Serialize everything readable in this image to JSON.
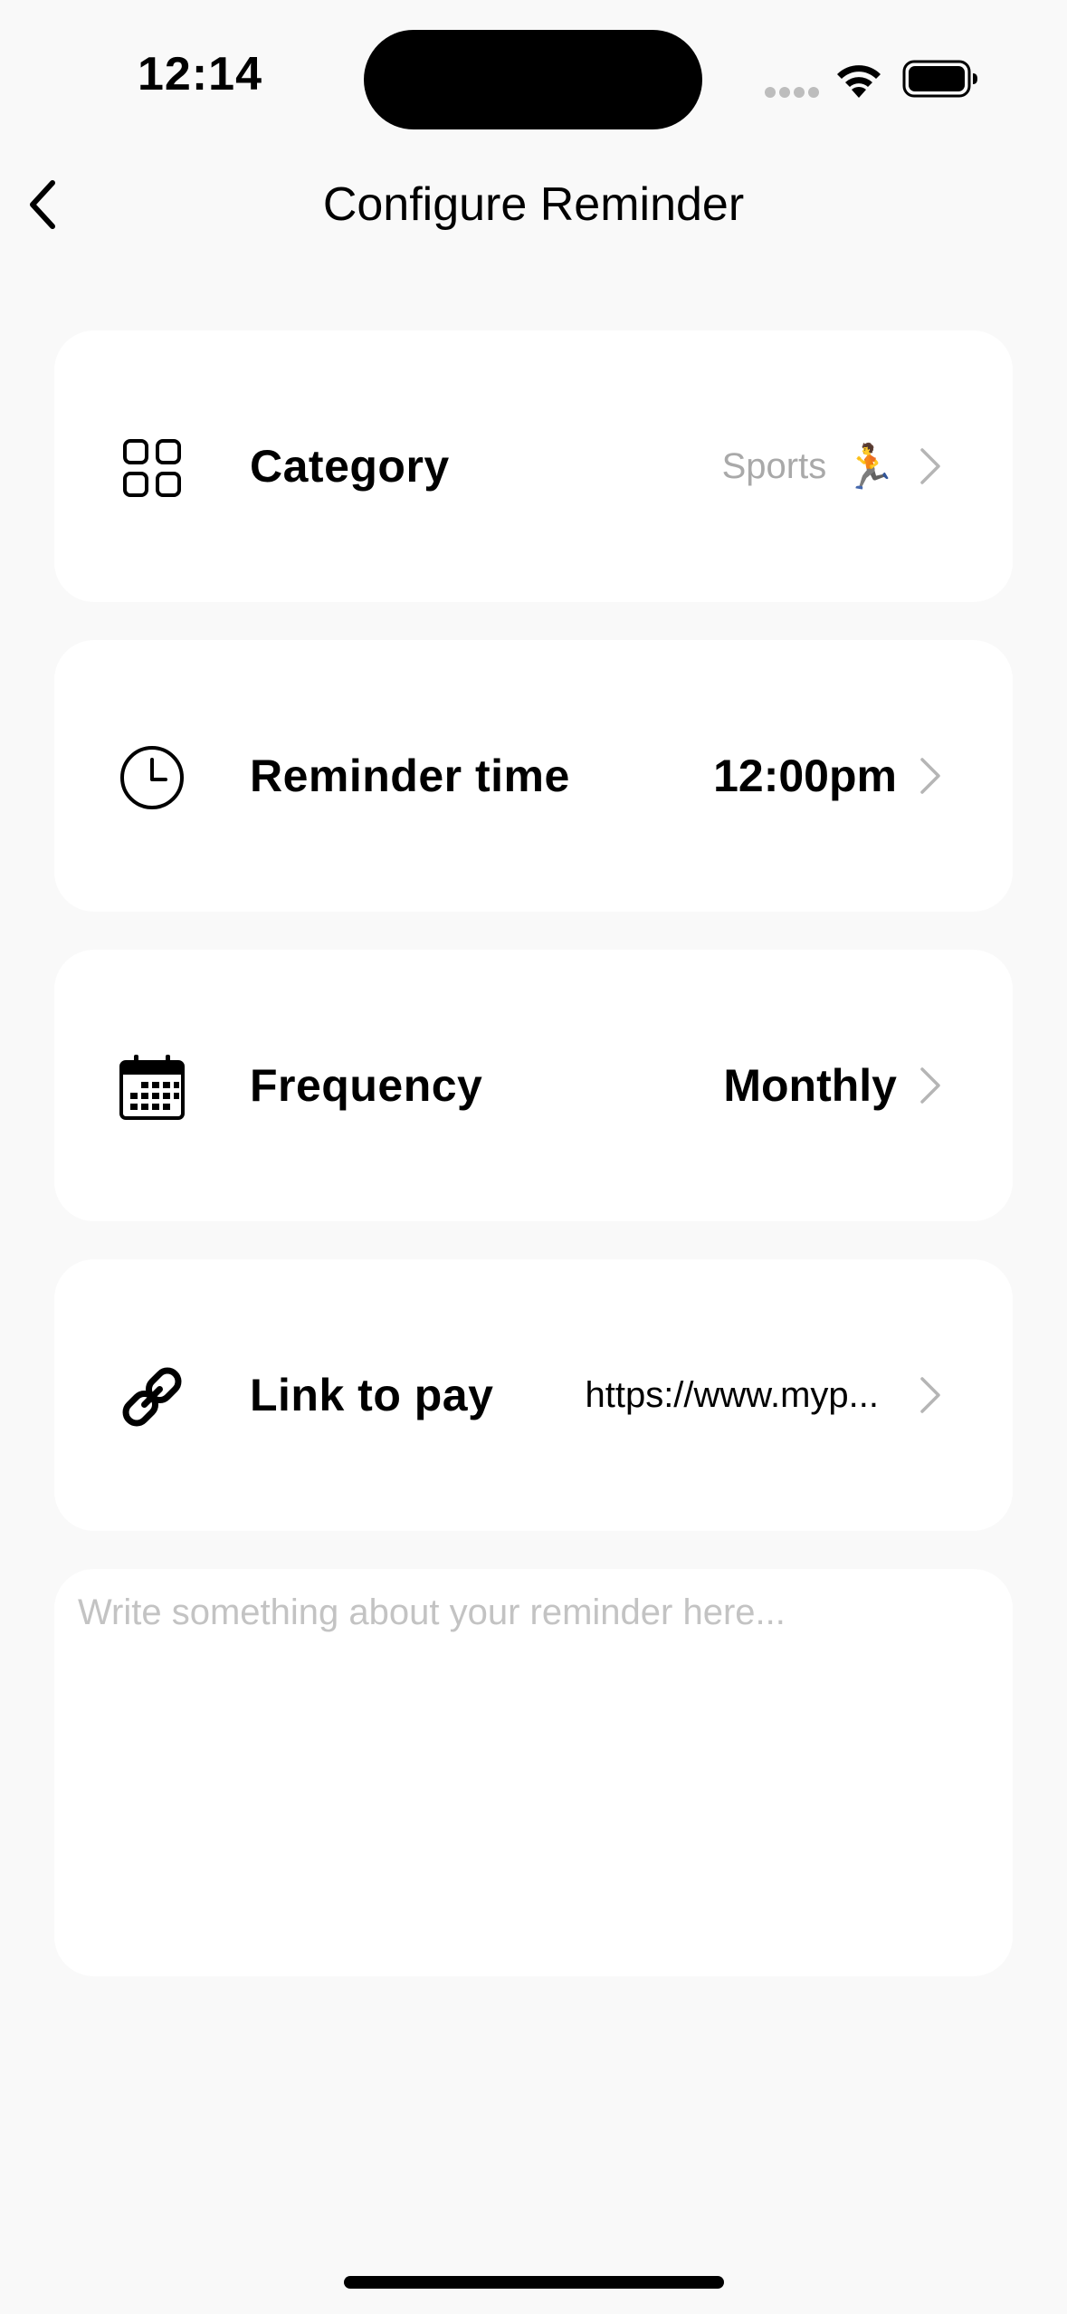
{
  "status_bar": {
    "time": "12:14"
  },
  "nav": {
    "title": "Configure Reminder",
    "back_icon": "chevron-left-icon"
  },
  "rows": [
    {
      "label": "Category",
      "value": "Sports",
      "value_emoji": "🏃",
      "icon": "grid-icon"
    },
    {
      "label": "Reminder time",
      "value": "12:00pm",
      "icon": "clock-icon"
    },
    {
      "label": "Frequency",
      "value": "Monthly",
      "icon": "calendar-icon"
    },
    {
      "label": "Link to pay",
      "value": "https://www.myp...",
      "icon": "link-icon"
    }
  ],
  "notes": {
    "placeholder": "Write something about your reminder here..."
  },
  "colors": {
    "background": "#f9f9f9",
    "card": "#ffffff",
    "muted_text": "#a9a9a9",
    "placeholder": "#c3c3c3",
    "chevron": "#b5b5b5"
  }
}
